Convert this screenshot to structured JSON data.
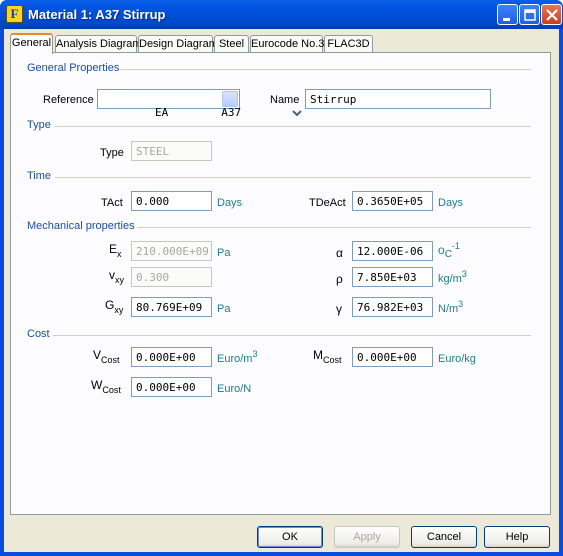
{
  "window": {
    "title": "Material 1: A37 Stirrup"
  },
  "tabs": [
    {
      "label": "General"
    },
    {
      "label": "Analysis Diagram"
    },
    {
      "label": "Design Diagram"
    },
    {
      "label": "Steel"
    },
    {
      "label": "Eurocode No.3"
    },
    {
      "label": "FLAC3D"
    }
  ],
  "general": {
    "heading": "General Properties",
    "reference_label": "Reference",
    "reference_value": "EA        A37",
    "name_label": "Name",
    "name_value": "Stirrup"
  },
  "type": {
    "heading": "Type",
    "type_label": "Type",
    "type_value": "STEEL"
  },
  "time": {
    "heading": "Time",
    "tact_label": "TAct",
    "tact_value": "0.000",
    "tact_unit": "Days",
    "tdeact_label": "TDeAct",
    "tdeact_value": "0.3650E+05",
    "tdeact_unit": "Days"
  },
  "mech": {
    "heading": "Mechanical properties",
    "ex_main": "E",
    "ex_sub": "x",
    "ex_value": "210.000E+09",
    "ex_unit": "Pa",
    "alpha_label": "α",
    "alpha_value": "12.000E-06",
    "alpha_unit_main": "o",
    "alpha_unit_c": "C",
    "alpha_unit_sup": "-1",
    "nu_main": "v",
    "nu_sub": "xy",
    "nu_value": "0.300",
    "rho_label": "ρ",
    "rho_value": "7.850E+03",
    "rho_unit": "kg/m",
    "rho_unit_sup": "3",
    "g_main": "G",
    "g_sub": "xy",
    "g_value": "80.769E+09",
    "g_unit": "Pa",
    "gamma_label": "γ",
    "gamma_value": "76.982E+03",
    "gamma_unit": "N/m",
    "gamma_unit_sup": "3"
  },
  "cost": {
    "heading": "Cost",
    "v_main": "V",
    "v_sub": "Cost",
    "v_value": "0.000E+00",
    "v_unit": "Euro/m",
    "v_unit_sup": "3",
    "m_main": "M",
    "m_sub": "Cost",
    "m_value": "0.000E+00",
    "m_unit": "Euro/kg",
    "w_main": "W",
    "w_sub": "Cost",
    "w_value": "0.000E+00",
    "w_unit": "Euro/N"
  },
  "buttons": {
    "ok": "OK",
    "apply": "Apply",
    "cancel": "Cancel",
    "help": "Help"
  }
}
